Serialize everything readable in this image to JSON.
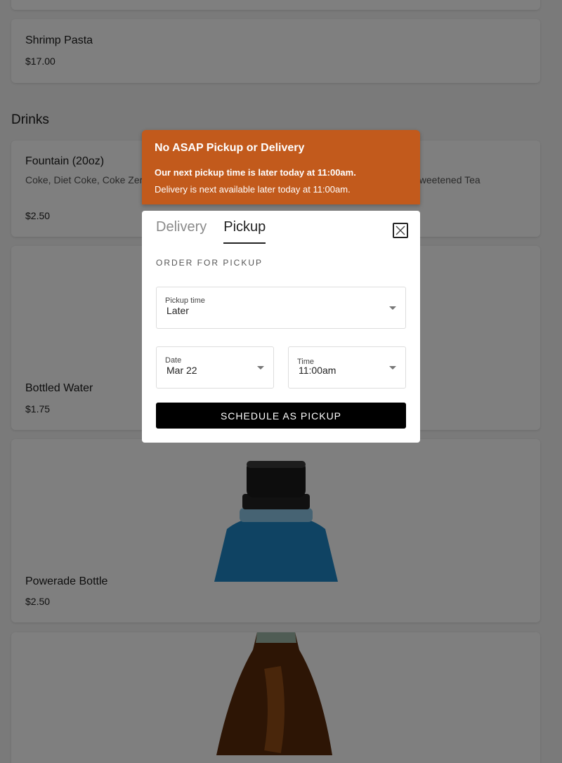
{
  "menu": {
    "section_title": "Drinks",
    "items": [
      {
        "name": "Shrimp Pasta",
        "price": "$17.00"
      },
      {
        "name": "Fountain (20oz)",
        "description": "Coke, Diet Coke, Coke Zero, Dr. Pepper, Diet Dr. Pepper, Sprite, Mr. Pibb, Sweet Tea, Unsweetened Tea",
        "price": "$2.50"
      },
      {
        "name": "Bottled Water",
        "price": "$1.75"
      },
      {
        "name": "Powerade Bottle",
        "price": "$2.50"
      }
    ]
  },
  "alert": {
    "title": "No ASAP Pickup or Delivery",
    "line1": "Our next pickup time is later today at 11:00am.",
    "line2": "Delivery is next available later today at 11:00am."
  },
  "modal": {
    "tabs": [
      "Delivery",
      "Pickup"
    ],
    "active_tab": "Pickup",
    "section_label": "ORDER FOR PICKUP",
    "pickup_time": {
      "label": "Pickup time",
      "value": "Later"
    },
    "date": {
      "label": "Date",
      "value": "Mar 22"
    },
    "time": {
      "label": "Time",
      "value": "11:00am"
    },
    "submit_label": "SCHEDULE AS PICKUP"
  },
  "colors": {
    "alert_bg": "#c25a1c",
    "button_bg": "#000000",
    "overlay": "rgba(0,0,0,0.5)"
  },
  "icons": [
    "close-icon",
    "chevron-down-icon"
  ]
}
